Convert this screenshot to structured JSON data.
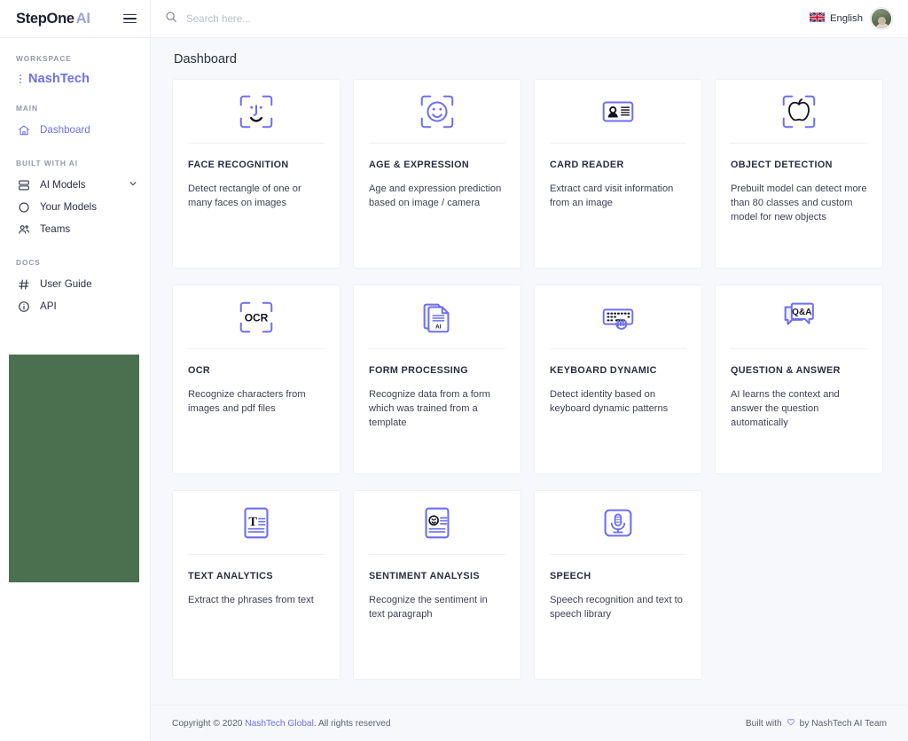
{
  "app": {
    "brand_primary": "StepOne",
    "brand_secondary": "AI",
    "accent_color": "#6c6ff0",
    "promo_color": "#4a7050"
  },
  "sidebar": {
    "menu_icon": "hamburger-icon",
    "sections": [
      {
        "label": "WORKSPACE",
        "type": "workspace",
        "workspace_name": "NashTech"
      },
      {
        "label": "MAIN",
        "type": "nav",
        "items": [
          {
            "label": "Dashboard",
            "icon": "home-icon",
            "active": true
          }
        ]
      },
      {
        "label": "BUILT WITH AI",
        "type": "nav",
        "items": [
          {
            "label": "AI Models",
            "icon": "layers-icon",
            "active": false,
            "chevron": "chevron-down-icon"
          },
          {
            "label": "Your Models",
            "icon": "circle-icon",
            "active": false
          },
          {
            "label": "Teams",
            "icon": "users-icon",
            "active": false
          }
        ]
      },
      {
        "label": "DOCS",
        "type": "nav",
        "items": [
          {
            "label": "User Guide",
            "icon": "hash-icon",
            "active": false
          },
          {
            "label": "API",
            "icon": "info-icon",
            "active": false
          }
        ]
      }
    ]
  },
  "topbar": {
    "search": {
      "icon": "search-icon",
      "placeholder": "Search here...",
      "value": ""
    },
    "language": {
      "flag": "uk-flag-icon",
      "label": "English"
    },
    "avatar": "user-avatar"
  },
  "main": {
    "page_title": "Dashboard",
    "cards": [
      {
        "icon": "face-recognition-icon",
        "title": "FACE RECOGNITION",
        "description": "Detect rectangle of one or many faces on images"
      },
      {
        "icon": "age-expression-icon",
        "title": "AGE & EXPRESSION",
        "description": "Age and expression prediction based on image / camera"
      },
      {
        "icon": "card-reader-icon",
        "title": "CARD READER",
        "description": "Extract card visit information from an image"
      },
      {
        "icon": "object-detection-icon",
        "title": "OBJECT DETECTION",
        "description": "Prebuilt model can detect more than 80 classes and custom model for new objects"
      },
      {
        "icon": "ocr-icon",
        "title": "OCR",
        "description": "Recognize characters from images and pdf files"
      },
      {
        "icon": "form-processing-icon",
        "title": "FORM PROCESSING",
        "description": "Recognize data from a form which was trained from a template"
      },
      {
        "icon": "keyboard-dynamic-icon",
        "title": "KEYBOARD DYNAMIC",
        "description": "Detect identity based on keyboard dynamic patterns"
      },
      {
        "icon": "question-answer-icon",
        "title": "QUESTION & ANSWER",
        "description": "AI learns the context and answer the question automatically"
      },
      {
        "icon": "text-analytics-icon",
        "title": "TEXT ANALYTICS",
        "description": "Extract the phrases from text"
      },
      {
        "icon": "sentiment-analysis-icon",
        "title": "SENTIMENT ANALYSIS",
        "description": "Recognize the sentiment in text paragraph"
      },
      {
        "icon": "speech-icon",
        "title": "SPEECH",
        "description": "Speech recognition and text to speech library"
      }
    ]
  },
  "footer": {
    "copyright_prefix": "Copyright © 2020 ",
    "copyright_link": "NashTech Global",
    "copyright_suffix": ". All rights reserved",
    "built_prefix": "Built with",
    "heart_icon": "heart-icon",
    "built_suffix": "by NashTech AI Team"
  }
}
